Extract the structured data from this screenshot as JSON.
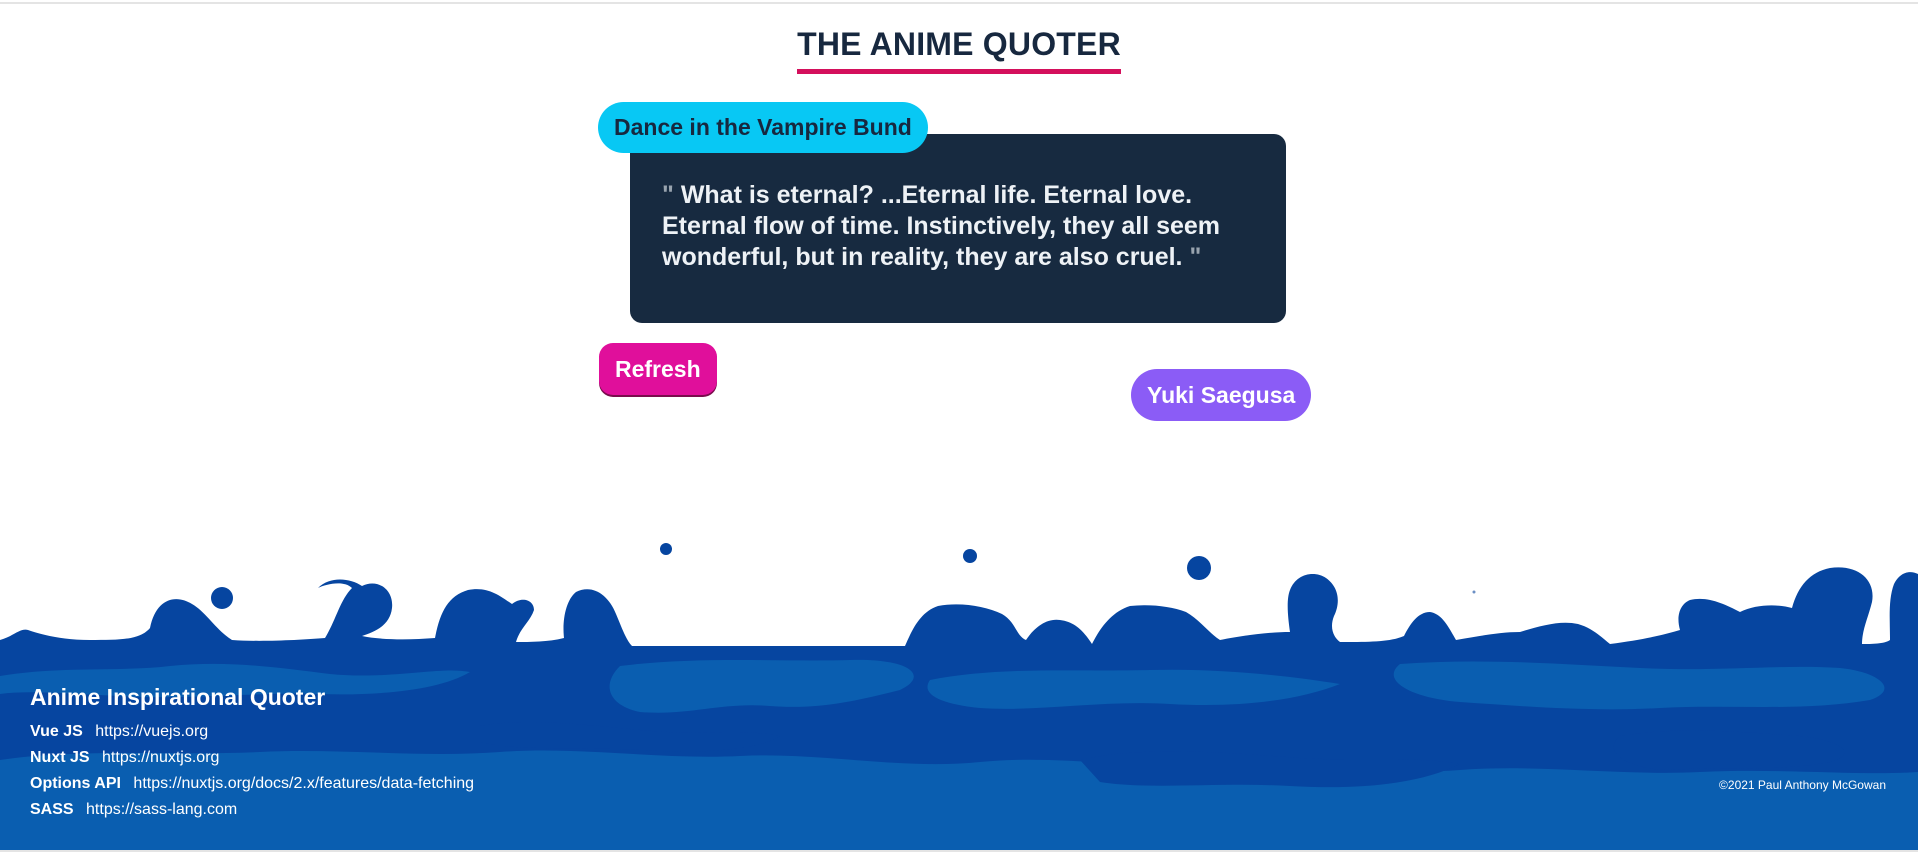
{
  "header": {
    "title": "THE ANIME QUOTER"
  },
  "quote": {
    "anime": "Dance in the Vampire Bund",
    "open_mark": "\"",
    "text": "What is eternal? ...Eternal life. Eternal love. Eternal flow of time. Instinctively, they all seem wonderful, but in reality, they are also cruel.",
    "close_mark": "\"",
    "character": "Yuki Saegusa"
  },
  "actions": {
    "refresh_label": "Refresh"
  },
  "footer": {
    "title": "Anime Inspirational Quoter",
    "links": [
      {
        "label": "Vue JS",
        "url": "https://vuejs.org"
      },
      {
        "label": "Nuxt JS",
        "url": "https://nuxtjs.org"
      },
      {
        "label": "Options API",
        "url": "https://nuxtjs.org/docs/2.x/features/data-fetching"
      },
      {
        "label": "SASS",
        "url": "https://sass-lang.com"
      }
    ],
    "copyright": "©2021 Paul Anthony McGowan"
  },
  "colors": {
    "title_text": "#17283f",
    "title_underline": "#d4105c",
    "quote_card": "#172a40",
    "anime_badge": "#08c8f4",
    "refresh_button": "#e00f9b",
    "character_badge": "#8b5cf6",
    "footer_dark_blue": "#0645a0",
    "footer_light_blue": "#0a5eb0"
  }
}
